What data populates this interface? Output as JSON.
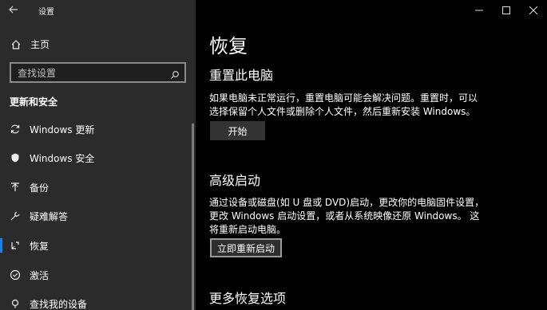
{
  "window": {
    "title": "设置"
  },
  "sidebar": {
    "home_label": "主页",
    "search_placeholder": "查找设置",
    "section_title": "更新和安全",
    "items": [
      {
        "label": "Windows 更新",
        "icon": "sync-icon"
      },
      {
        "label": "Windows 安全",
        "icon": "shield-icon"
      },
      {
        "label": "备份",
        "icon": "backup-icon"
      },
      {
        "label": "疑难解答",
        "icon": "wrench-icon"
      },
      {
        "label": "恢复",
        "icon": "recovery-icon",
        "active": true
      },
      {
        "label": "激活",
        "icon": "check-circle-icon"
      },
      {
        "label": "查找我的设备",
        "icon": "find-device-icon"
      }
    ]
  },
  "main": {
    "title": "恢复",
    "reset": {
      "heading": "重置此电脑",
      "description": "如果电脑未正常运行，重置电脑可能会解决问题。重置时，可以选择保留个人文件或删除个人文件，然后重新安装 Windows。",
      "button": "开始"
    },
    "advanced": {
      "heading": "高级启动",
      "description": "通过设备或磁盘(如 U 盘或 DVD)启动，更改你的电脑固件设置，更改 Windows 启动设置，或者从系统映像还原 Windows。 这将重新启动电脑。",
      "button": "立即重新启动"
    },
    "more": {
      "heading": "更多恢复选项"
    }
  },
  "colors": {
    "sidebar_bg": "#2b2b2b",
    "main_bg": "#000000",
    "accent": "#0a84ff"
  }
}
